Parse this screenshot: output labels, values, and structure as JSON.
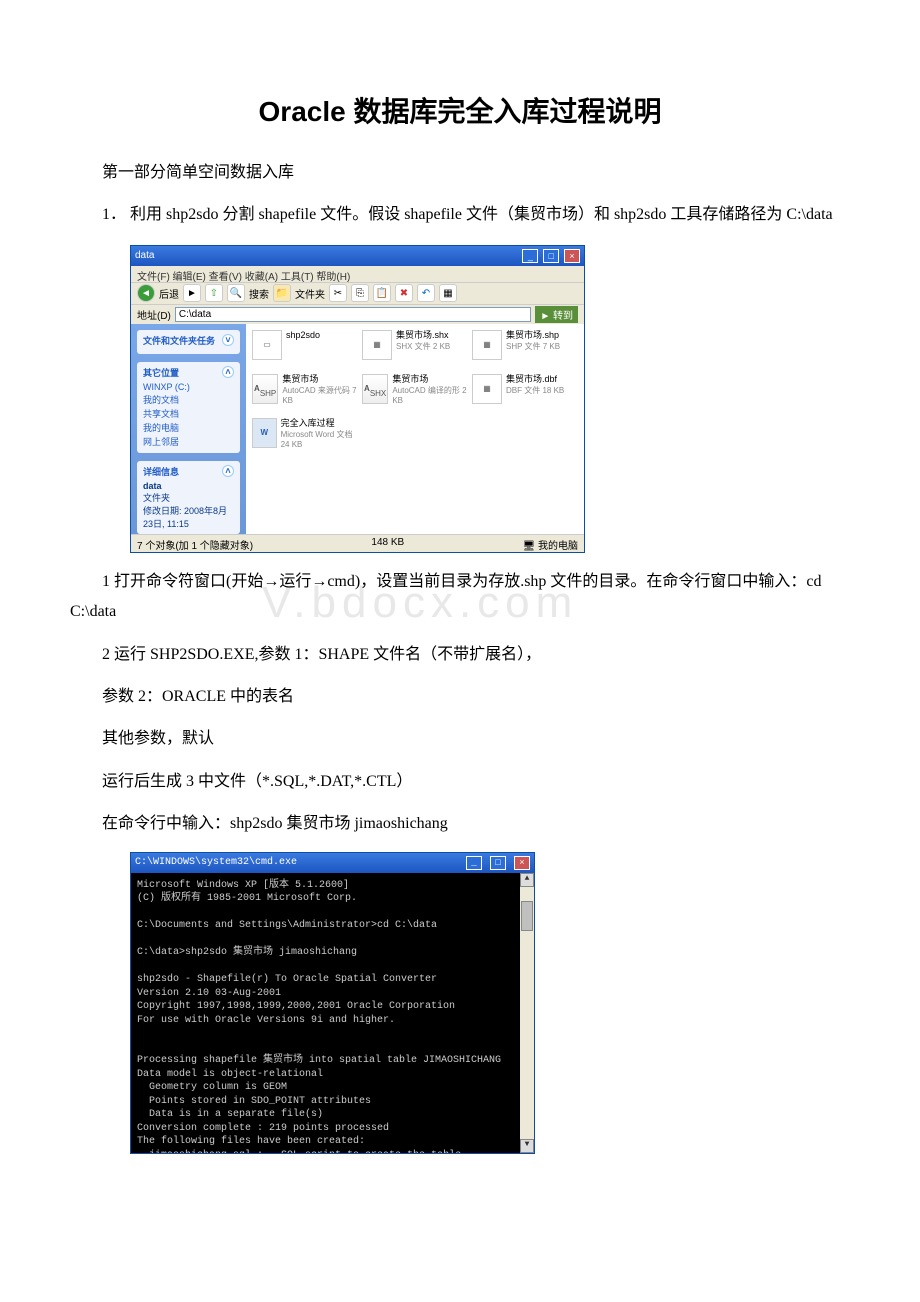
{
  "title": "Oracle 数据库完全入库过程说明",
  "section1_heading": "第一部分简单空间数据入库",
  "para1": "1． 利用 shp2sdo 分割 shapefile 文件。假设 shapefile 文件（集贸市场）和 shp2sdo 工具存储路径为 C:\\data",
  "explorer": {
    "title": "data",
    "menu": "文件(F)  编辑(E)  查看(V)  收藏(A)  工具(T)  帮助(H)",
    "toolbar": {
      "back": "后退",
      "search": "搜索",
      "folders": "文件夹"
    },
    "address_label": "地址(D)",
    "address_value": "C:\\data",
    "go": "转到",
    "panels": {
      "tasks_hd": "文件和文件夹任务",
      "other_hd": "其它位置",
      "other_items": [
        "WINXP (C:)",
        "我的文档",
        "共享文档",
        "我的电脑",
        "网上邻居"
      ],
      "details_hd": "详细信息",
      "details_name": "data",
      "details_type": "文件夹",
      "details_date": "修改日期: 2008年8月23日, 11:15"
    },
    "files": [
      {
        "name": "shp2sdo",
        "sub": "",
        "icon": "exe"
      },
      {
        "name": "集贸市场.shx",
        "sub": "SHX 文件\n2 KB",
        "icon": "shx"
      },
      {
        "name": "集贸市场.shp",
        "sub": "SHP 文件\n7 KB",
        "icon": "shp"
      },
      {
        "name": "集贸市场",
        "sub": "AutoCAD 来源代码\n7 KB",
        "icon": "SHP"
      },
      {
        "name": "集贸市场",
        "sub": "AutoCAD 编译的形\n2 KB",
        "icon": "SHX"
      },
      {
        "name": "集贸市场.dbf",
        "sub": "DBF 文件\n18 KB",
        "icon": "dbf"
      },
      {
        "name": "完全入库过程",
        "sub": "Microsoft Word 文档\n24 KB",
        "icon": "W"
      }
    ],
    "status_left": "7 个对象(加 1 个隐藏对象)",
    "status_mid": "148 KB",
    "status_right": "我的电脑"
  },
  "para2a": "1 打开命令符窗口(开始→运行→cmd)，设置当前目录为存放.shp 文件的目录。在命令行窗口中输入：cd C:\\data",
  "para3": "2 运行 SHP2SDO.EXE,参数 1：SHAPE 文件名（不带扩展名），",
  "para4": " 参数 2：ORACLE 中的表名",
  "para5": " 其他参数，默认",
  "para6": " 运行后生成 3 中文件（*.SQL,*.DAT,*.CTL）",
  "para7": " 在命令行中输入：shp2sdo 集贸市场 jimaoshichang",
  "cmd": {
    "title": "C:\\WINDOWS\\system32\\cmd.exe",
    "lines": "Microsoft Windows XP [版本 5.1.2600]\n(C) 版权所有 1985-2001 Microsoft Corp.\n\nC:\\Documents and Settings\\Administrator>cd C:\\data\n\nC:\\data>shp2sdo 集贸市场 jimaoshichang\n\nshp2sdo - Shapefile(r) To Oracle Spatial Converter\nVersion 2.10 03-Aug-2001\nCopyright 1997,1998,1999,2000,2001 Oracle Corporation\nFor use with Oracle Versions 9i and higher.\n\n\nProcessing shapefile 集贸市场 into spatial table JIMAOSHICHANG\nData model is object-relational\n  Geometry column is GEOM\n  Points stored in SDO_POINT attributes\n  Data is in a separate file(s)\nConversion complete : 219 points processed\nThe following files have been created:\n  jimaoshichang.sql :   SQL script to create the table\n  jimaoshichang.ctl :   Control file for loading the table\n  jimaoshichang.dat :   Data file\n\nC:\\data>_"
  }
}
